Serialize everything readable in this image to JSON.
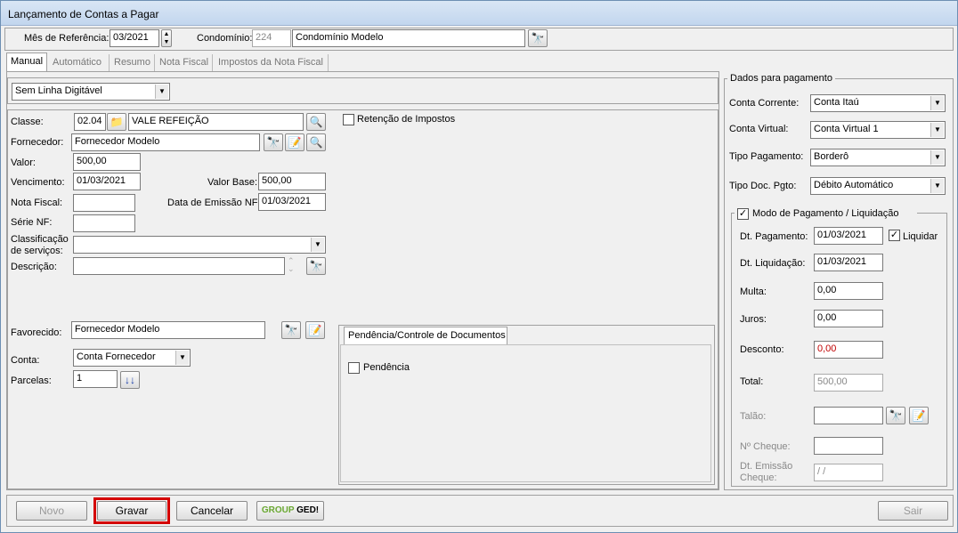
{
  "window": {
    "title": "Lançamento de Contas a Pagar"
  },
  "header": {
    "mes_label": "Mês de Referência:",
    "mes_value": "03/2021",
    "condominio_label": "Condomínio:",
    "condominio_code": "224",
    "condominio_name": "Condomínio Modelo"
  },
  "tabs": [
    "Manual",
    "Automático",
    "Resumo",
    "Nota Fiscal",
    "Impostos da Nota Fiscal"
  ],
  "linha_digitavel": "Sem Linha Digitável",
  "form": {
    "classe_label": "Classe:",
    "classe_code": "02.04",
    "classe_name": "VALE REFEIÇÃO",
    "fornecedor_label": "Fornecedor:",
    "fornecedor_value": "Fornecedor Modelo",
    "valor_label": "Valor:",
    "valor_value": "500,00",
    "vencimento_label": "Vencimento:",
    "vencimento_value": "01/03/2021",
    "valor_base_label": "Valor Base:",
    "valor_base_value": "500,00",
    "nota_fiscal_label": "Nota Fiscal:",
    "nota_fiscal_value": "",
    "data_emissao_label": "Data de Emissão NF:",
    "data_emissao_value": "01/03/2021",
    "serie_label": "Série NF:",
    "serie_value": "",
    "classificacao_label1": "Classificação",
    "classificacao_label2": "de serviços:",
    "classificacao_value": "",
    "descricao_label": "Descrição:",
    "descricao_value": "",
    "retencao_label": "Retenção de Impostos",
    "favorecido_label": "Favorecido:",
    "favorecido_value": "Fornecedor Modelo",
    "conta_label": "Conta:",
    "conta_value": "Conta Fornecedor",
    "parcelas_label": "Parcelas:",
    "parcelas_value": "1"
  },
  "pendencia": {
    "tab_label": "Pendência/Controle de Documentos",
    "check_label": "Pendência"
  },
  "pagamento": {
    "group_title": "Dados para pagamento",
    "conta_corrente_label": "Conta Corrente:",
    "conta_corrente_value": "Conta Itaú",
    "conta_virtual_label": "Conta Virtual:",
    "conta_virtual_value": "Conta Virtual 1",
    "tipo_pagamento_label": "Tipo Pagamento:",
    "tipo_pagamento_value": "Borderô",
    "tipo_doc_label": "Tipo Doc. Pgto:",
    "tipo_doc_value": "Débito Automático",
    "modo_title": "Modo de Pagamento / Liquidação",
    "dt_pagamento_label": "Dt. Pagamento:",
    "dt_pagamento_value": "01/03/2021",
    "liquidar_label": "Liquidar",
    "dt_liquidacao_label": "Dt. Liquidação:",
    "dt_liquidacao_value": "01/03/2021",
    "multa_label": "Multa:",
    "multa_value": "0,00",
    "juros_label": "Juros:",
    "juros_value": "0,00",
    "desconto_label": "Desconto:",
    "desconto_value": "0,00",
    "total_label": "Total:",
    "total_value": "500,00",
    "talao_label": "Talão:",
    "talao_value": "",
    "cheque_label": "Nº Cheque:",
    "cheque_value": "",
    "dt_emissao_cheque_label1": "Dt. Emissão",
    "dt_emissao_cheque_label2": "Cheque:",
    "dt_emissao_cheque_value": " /  /"
  },
  "footer": {
    "novo": "Novo",
    "gravar": "Gravar",
    "cancelar": "Cancelar",
    "ged_group": "GROUP",
    "ged": "GED!",
    "sair": "Sair"
  },
  "colors": {
    "highlight": "#d40000",
    "desconto": "#c00000"
  }
}
